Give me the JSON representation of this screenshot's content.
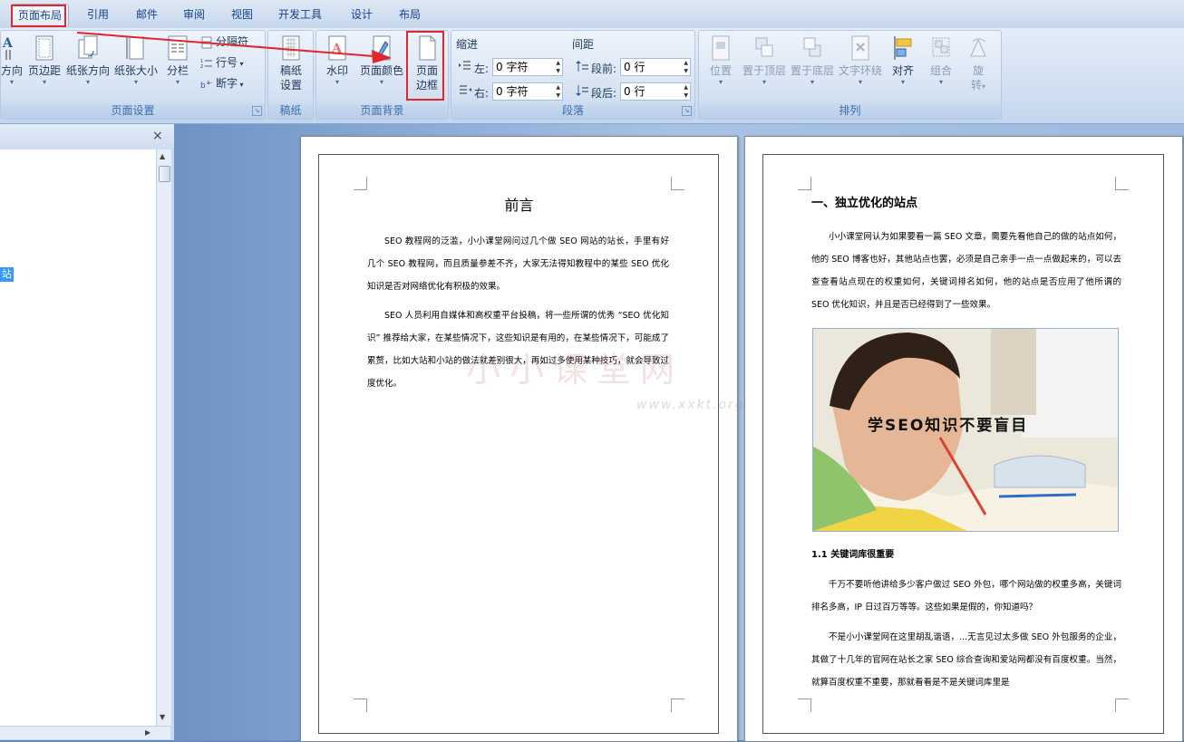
{
  "tabs": [
    {
      "label": "页面布局",
      "active": true
    },
    {
      "label": "引用"
    },
    {
      "label": "邮件"
    },
    {
      "label": "审阅"
    },
    {
      "label": "视图"
    },
    {
      "label": "开发工具"
    },
    {
      "label": "设计"
    },
    {
      "label": "布局"
    }
  ],
  "ribbon": {
    "page_setup": {
      "label": "页面设置",
      "direction": "方向",
      "margins": "页边距",
      "orientation": "纸张方向",
      "size": "纸张大小",
      "columns": "分栏",
      "breaks": "分隔符",
      "line_numbers": "行号",
      "hyphenation": "断字"
    },
    "manuscript": {
      "label": "稿纸",
      "settings_line1": "稿纸",
      "settings_line2": "设置"
    },
    "page_background": {
      "label": "页面背景",
      "watermark": "水印",
      "page_color": "页面颜色",
      "page_border_line1": "页面",
      "page_border_line2": "边框"
    },
    "paragraph": {
      "label": "段落",
      "indent_title": "缩进",
      "spacing_title": "间距",
      "left_label": "左:",
      "left_value": "0 字符",
      "right_label": "右:",
      "right_value": "0 字符",
      "before_label": "段前:",
      "before_value": "0 行",
      "after_label": "段后:",
      "after_value": "0 行"
    },
    "arrange": {
      "label": "排列",
      "position": "位置",
      "bring_front": "置于顶层",
      "send_back": "置于底层",
      "text_wrap": "文字环绕",
      "align": "对齐",
      "group": "组合",
      "rotate_line1": "旋",
      "rotate_line2": "转"
    }
  },
  "nav": {
    "close": "×",
    "selected_fragment": "站"
  },
  "page1": {
    "title": "前言",
    "para1": "SEO 教程网的泛滥，小小课堂网问过几个做 SEO 网站的站长，手里有好几个 SEO 教程网，而且质量参差不齐，大家无法得知教程中的某些 SEO 优化知识是否对网络优化有积极的效果。",
    "para2": "SEO 人员利用自媒体和高权重平台投稿，将一些所谓的优秀 “SEO 优化知识” 推荐给大家，在某些情况下，这些知识是有用的，在某些情况下，可能成了累赘，比如大站和小站的做法就差别很大，再如过多使用某种技巧，就会导致过度优化。",
    "watermark_main": "小小课堂网",
    "watermark_url": "www.xxkt.org"
  },
  "page2": {
    "heading": "一、独立优化的站点",
    "para1": "小小课堂网认为如果要看一篇 SEO 文章，需要先看他自己的做的站点如何，他的 SEO 博客也好，其他站点也罢，必须是自己亲手一点一点做起来的，可以去查查看站点现在的权重如何，关键词排名如何，他的站点是否应用了他所谓的 SEO 优化知识，并且是否已经得到了一些效果。",
    "image_caption": "学SEO知识不要盲目",
    "subheading": "1.1 关键词库很重要",
    "para2": "千万不要听他讲给多少客户做过 SEO 外包，哪个网站做的权重多高，关键词排名多高，IP 日过百万等等。这些如果是假的，你知道吗？",
    "para3": "不是小小课堂网在这里胡乱谐语，...无言见过太多做 SEO 外包服务的企业，其做了十几年的官网在站长之家 SEO 综合查询和爱站网都没有百度权重。当然，就算百度权重不重要，那就看看是不是关键词库里是"
  },
  "colors": {
    "highlight": "#e3262b",
    "ribbon_text": "#1e395b"
  }
}
